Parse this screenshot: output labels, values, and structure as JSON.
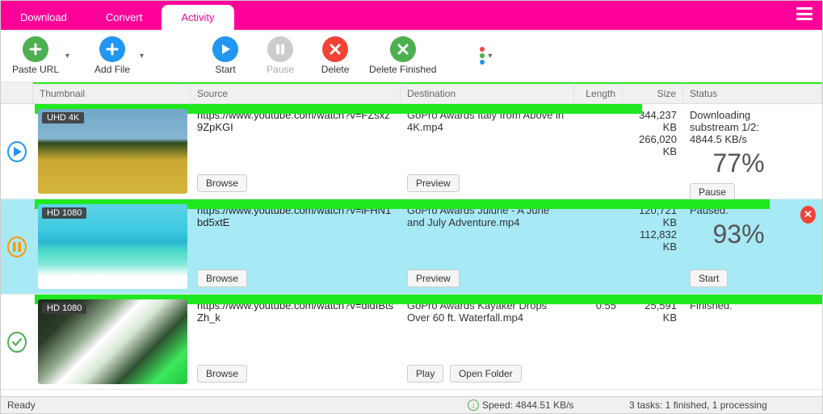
{
  "tabs": {
    "download": "Download",
    "convert": "Convert",
    "activity": "Activity"
  },
  "toolbar": {
    "paste_url": "Paste URL",
    "add_file": "Add File",
    "start": "Start",
    "pause": "Pause",
    "delete": "Delete",
    "delete_finished": "Delete Finished"
  },
  "headers": {
    "thumbnail": "Thumbnail",
    "source": "Source",
    "destination": "Destination",
    "length": "Length",
    "size": "Size",
    "status": "Status"
  },
  "rows": [
    {
      "badge": "UHD 4K",
      "source": "https://www.youtube.com/watch?v=FZsxz9ZpKGI",
      "dest": "GoPro Awards  Italy from Above in 4K.mp4",
      "length": "",
      "size1": "344,237 KB",
      "size2": "266,020 KB",
      "status": "Downloading substream 1/2: 4844.5 KB/s",
      "percent": "77%",
      "btn_source": "Browse",
      "btn_dest": "Preview",
      "btn_status": "Pause"
    },
    {
      "badge": "HD 1080",
      "source": "https://www.youtube.com/watch?v=iFHN1bd5xtE",
      "dest": "GoPro Awards  Julune - A June and July Adventure.mp4",
      "length": "",
      "size1": "120,721 KB",
      "size2": "112,832 KB",
      "status": "Paused.",
      "percent": "93%",
      "btn_source": "Browse",
      "btn_dest": "Preview",
      "btn_status": "Start"
    },
    {
      "badge": "HD 1080",
      "source": "https://www.youtube.com/watch?v=dldIBtsZh_k",
      "dest": "GoPro Awards  Kayaker Drops Over 60 ft. Waterfall.mp4",
      "length": "0:55",
      "size1": "25,591 KB",
      "size2": "",
      "status": "Finished.",
      "percent": "",
      "btn_source": "Browse",
      "btn_dest1": "Play",
      "btn_dest2": "Open Folder"
    }
  ],
  "statusbar": {
    "ready": "Ready",
    "speed": "Speed: 4844.51 KB/s",
    "tasks": "3 tasks: 1 finished, 1 processing"
  }
}
